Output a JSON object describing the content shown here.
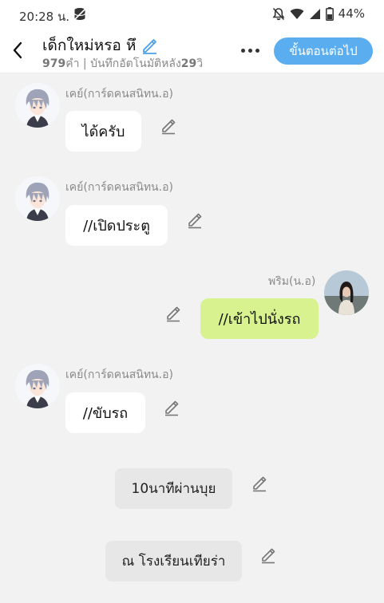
{
  "status": {
    "time": "20:28 น.",
    "battery": "44%"
  },
  "header": {
    "title": "เด็กใหม่หรอ หึ",
    "subtitle_count": "979",
    "subtitle_text": "คำ | บันทึกอัตโนมัติหลัง",
    "subtitle_seconds": "29",
    "subtitle_unit": "วิ",
    "next_label": "ขั้นตอนต่อไป"
  },
  "messages": [
    {
      "sender": "เคย์(การ์ดคนสนิทน.อ)",
      "text": "ได้ครับ"
    },
    {
      "sender": "เคย์(การ์ดคนสนิทน.อ)",
      "text": "//เปิดประตู"
    },
    {
      "sender": "พริม(น.อ)",
      "text": "//เข้าไปนั่งรถ"
    },
    {
      "sender": "เคย์(การ์ดคนสนิทน.อ)",
      "text": "//ขับรถ"
    }
  ],
  "narration": [
    {
      "text": "10นาทีผ่านบุย"
    },
    {
      "text": "ณ โรงเรียนเทียร่า"
    }
  ],
  "colors": {
    "accent": "#5aaef0",
    "my_bubble": "#d7f28f",
    "background": "#f2f2f2"
  },
  "icons": [
    "database-icon",
    "bell-off-icon",
    "wifi-icon",
    "signal-icon",
    "battery-icon",
    "back-icon",
    "pencil-icon",
    "more-icon"
  ]
}
